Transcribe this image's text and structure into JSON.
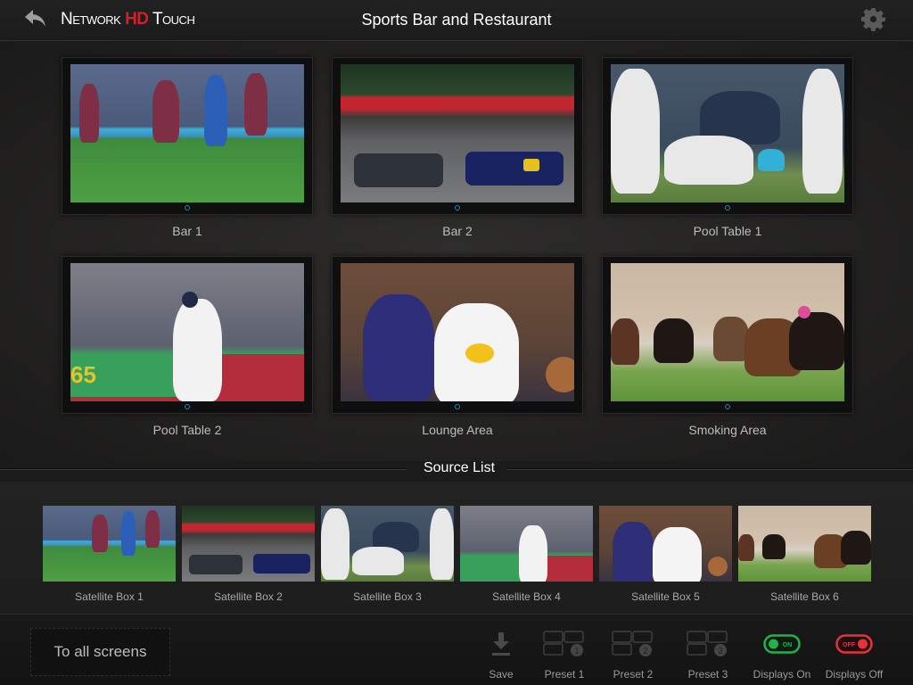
{
  "header": {
    "logo_part1": "Network",
    "logo_hd": "HD",
    "logo_part2": "Touch",
    "title": "Sports Bar and Restaurant",
    "back_icon": "back-arrow-icon",
    "settings_icon": "gear-icon"
  },
  "zones": [
    {
      "label": "Bar 1",
      "scene": "soccer"
    },
    {
      "label": "Bar 2",
      "scene": "f1"
    },
    {
      "label": "Pool Table 1",
      "scene": "football"
    },
    {
      "label": "Pool Table 2",
      "scene": "cricket"
    },
    {
      "label": "Lounge Area",
      "scene": "basketball"
    },
    {
      "label": "Smoking Area",
      "scene": "horses"
    }
  ],
  "source_list": {
    "title": "Source List",
    "sources": [
      {
        "label": "Satellite Box 1",
        "scene": "soccer"
      },
      {
        "label": "Satellite Box 2",
        "scene": "f1"
      },
      {
        "label": "Satellite Box 3",
        "scene": "football"
      },
      {
        "label": "Satellite Box 4",
        "scene": "cricket"
      },
      {
        "label": "Satellite Box 5",
        "scene": "basketball"
      },
      {
        "label": "Satellite Box 6",
        "scene": "horses"
      }
    ]
  },
  "footer": {
    "to_all_screens": "To all screens",
    "save": "Save",
    "presets": [
      "Preset 1",
      "Preset 2",
      "Preset 3"
    ],
    "preset_numbers": [
      "1",
      "2",
      "3"
    ],
    "displays_on": "Displays On",
    "displays_off": "Displays Off",
    "on_text": "ON",
    "off_text": "OFF"
  },
  "colors": {
    "logo_hd": "#d42028",
    "on_green": "#22b14c",
    "off_red": "#e8323a",
    "led_blue": "#2b7fae"
  }
}
